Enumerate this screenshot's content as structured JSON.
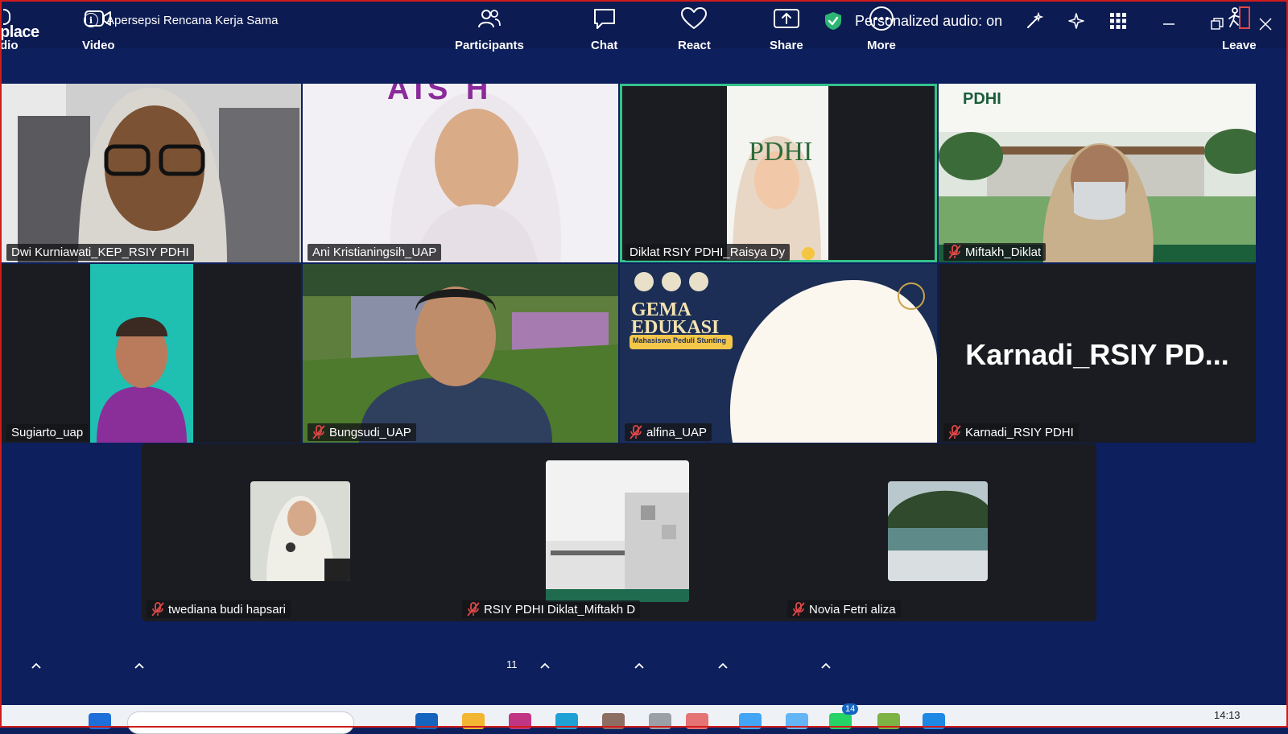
{
  "app": {
    "name": "place"
  },
  "meeting": {
    "title": "Apersepsi Rencana Kerja Sama"
  },
  "topbar": {
    "audio_status": "Personalized audio: on"
  },
  "tiles": [
    {
      "name": "Dwi Kurniawati_KEP_RSIY PDHI",
      "muted": false
    },
    {
      "name": "Ani Kristianingsih_UAP",
      "muted": false,
      "bg_text": "AIS H"
    },
    {
      "name": "Diklat RSIY PDHI_Raisya Dy",
      "muted": false,
      "bg_text": "PDHI"
    },
    {
      "name": "Miftakh_Diklat",
      "muted": true,
      "bg_text": "PDHI"
    },
    {
      "name": "Sugiarto_uap",
      "muted": false
    },
    {
      "name": "Bungsudi_UAP",
      "muted": true
    },
    {
      "name": "alfina_UAP",
      "muted": true,
      "bg_title": "GEMA EDUKASI",
      "bg_subtitle": "Mahasiswa Peduli Stunting"
    },
    {
      "name": "Karnadi_RSIY PDHI",
      "muted": true,
      "display_name": "Karnadi_RSIY  PD..."
    }
  ],
  "strip": [
    {
      "name": "twediana budi hapsari",
      "muted": true
    },
    {
      "name": "RSIY PDHI Diklat_Miftakh D",
      "muted": true
    },
    {
      "name": "Novia Fetri aliza",
      "muted": true
    }
  ],
  "toolbar": {
    "audio_label": "dio",
    "video_label": "Video",
    "participants_label": "Participants",
    "participants_count": "11",
    "chat_label": "Chat",
    "react_label": "React",
    "share_label": "Share",
    "more_label": "More",
    "leave_label": "Leave"
  },
  "taskbar": {
    "time": "14:13",
    "badge": "14"
  },
  "colors": {
    "active_speaker": "#34c28a",
    "muted_icon": "#e04848",
    "shield": "#2bb673",
    "leave": "#e04848"
  }
}
